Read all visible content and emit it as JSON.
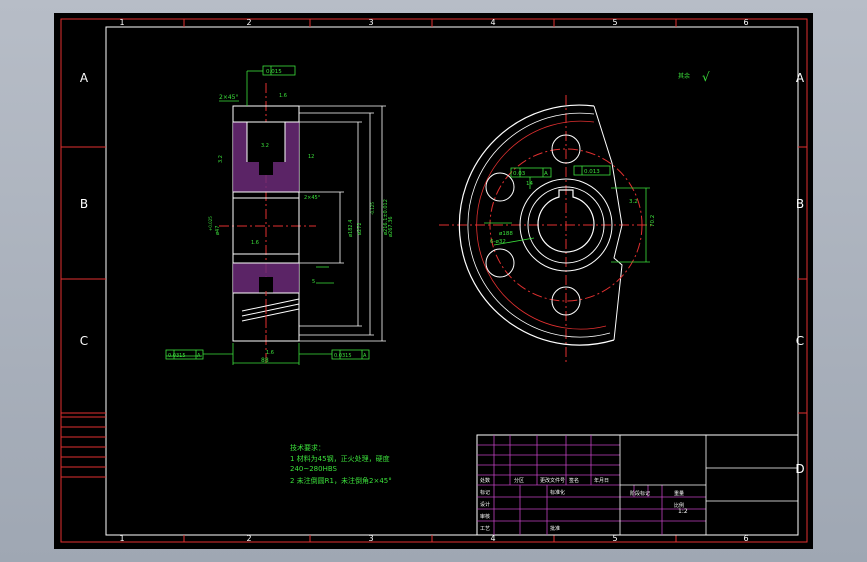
{
  "frame": {
    "col_numbers": [
      "1",
      "2",
      "3",
      "4",
      "5",
      "6"
    ],
    "row_letters": [
      "A",
      "B",
      "C",
      "D"
    ]
  },
  "front_view": {
    "runout_top": "0.015",
    "chamfer_top": "2×45°",
    "roughness_top": "1.6",
    "roughness_left": "3.2",
    "roughness_right": "12",
    "hub_width": "3.2",
    "chamfer_mid": "2×45°",
    "dia_bore": "ø47",
    "dia_bore_tol": "+0.025",
    "dia_hub": "ø182.4",
    "dia_root": "ø216.1±0.012",
    "dia_pitch": "ø272",
    "dia_tip": "ø267.36",
    "dia_tip_tol": "-0.125",
    "small_roughness": "1.6",
    "width_small": "5",
    "runout_left": "0.0315",
    "runout_left_datum": "A",
    "runout_right": "0.0315",
    "runout_right_datum": "A",
    "roughness_bottom": "1.6",
    "face_width": "88"
  },
  "side_view": {
    "tol_symmetry": "0.03",
    "tol_symmetry_datum": "A",
    "tol_flatness": "0.013",
    "dim_keyway": "14",
    "dim_keyway_depth": "70.2",
    "dim_bolt_circle": "ø188",
    "dim_hole": "6-ø32",
    "roughness_keyway": "3.2"
  },
  "roughness_note": {
    "label": "其余",
    "value": "√"
  },
  "tech_req": {
    "heading": "技术要求：",
    "line1": "1  材料为45钢，正火处理，硬度",
    "line2": "240~280HBS",
    "line3": "2  未注倒圆R1，未注倒角2×45°"
  },
  "title_block": {
    "row_labels": [
      "标记",
      "设计",
      "审核",
      "工艺"
    ],
    "header_labels": [
      "处数",
      "分区",
      "更改文件号",
      "签名",
      "年月日"
    ],
    "standardization": "标准化",
    "approval": "批准",
    "stage_label": "阶段标记",
    "weight_label": "重量",
    "scale_label": "比例",
    "scale_value": "1:2"
  }
}
